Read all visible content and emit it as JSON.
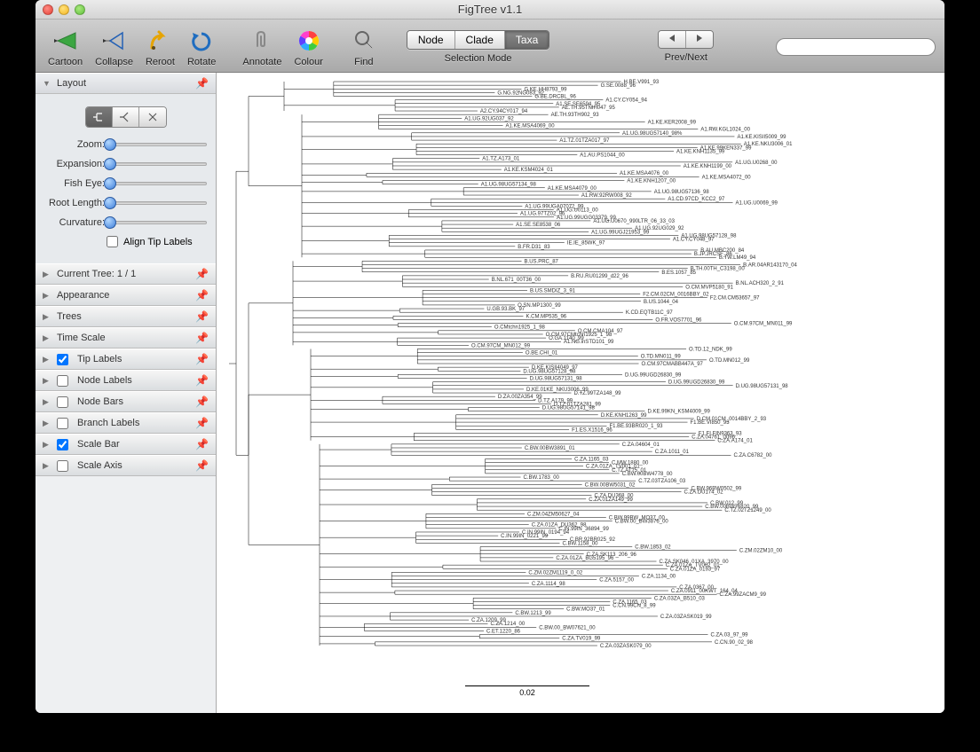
{
  "window": {
    "title": "FigTree v1.1"
  },
  "toolbar": {
    "cartoon": "Cartoon",
    "collapse": "Collapse",
    "reroot": "Reroot",
    "rotate": "Rotate",
    "annotate": "Annotate",
    "colour": "Colour",
    "find": "Find",
    "selection_mode_label": "Selection Mode",
    "selection_mode": {
      "node": "Node",
      "clade": "Clade",
      "taxa": "Taxa",
      "active": "Taxa"
    },
    "prev_next_label": "Prev/Next"
  },
  "search": {
    "placeholder": ""
  },
  "sidebar": {
    "layout": {
      "title": "Layout",
      "zoom": "Zoom:",
      "expansion": "Expansion:",
      "fish_eye": "Fish Eye:",
      "root_length": "Root Length:",
      "curvature": "Curvature:",
      "align_tip_labels": "Align Tip Labels"
    },
    "panels": [
      {
        "label": "Current Tree: 1 / 1",
        "checkbox": null
      },
      {
        "label": "Appearance",
        "checkbox": null
      },
      {
        "label": "Trees",
        "checkbox": null
      },
      {
        "label": "Time Scale",
        "checkbox": null
      },
      {
        "label": "Tip Labels",
        "checkbox": true
      },
      {
        "label": "Node Labels",
        "checkbox": false
      },
      {
        "label": "Node Bars",
        "checkbox": false
      },
      {
        "label": "Branch Labels",
        "checkbox": false
      },
      {
        "label": "Scale Bar",
        "checkbox": true
      },
      {
        "label": "Scale Axis",
        "checkbox": false
      }
    ]
  },
  "scalebar": {
    "value": "0.02"
  },
  "tip_labels": [
    "H.BE.V991_93",
    "G.SE.0088_96",
    "G.KE.HH8793_99",
    "G.NG.92NG083_92",
    "G.BE.DRCBL_96",
    "A1.CY.CY054_94",
    "A1.SE.SE6594_95",
    "AE.TH.95TNIH047_95",
    "A2.CY.94CY017_94",
    "AE.TH.93TH902_93",
    "A1.UG.92UG037_92",
    "A1.KE.KER2008_99",
    "A1.KE.MSA4069_00",
    "A1.RW.KGL1024_00",
    "A1.UG.98UG57140_98%",
    "A1.KE.KISII5009_99",
    "A1.TZ.01TZA017_97",
    "A1.KE.NKU3006_01",
    "A1.KE.99KEN337_99",
    "A1.KE.KNH1135_99",
    "A1.AU.PS1044_00",
    "A1.TZ.A173_01",
    "A1.UG.U0268_00",
    "A1.KE.KNH1199_00",
    "A1.KE.KSM4024_01",
    "A1.KE.MSA4076_00",
    "A1.KE.MSA4072_00",
    "A1.KE.KNH1207_00",
    "A1.UG.98UG57134_98",
    "A1.KE.MSA4079_00",
    "A1.UG.98UG57136_98",
    "A1.RW.92RW008_92",
    "A1.CD.97CD_KCC2_97",
    "A1.UG.U0069_99",
    "A1.UG.99UGA07072_99",
    "A1.UG.U0113_00",
    "A1.UG.97TZ02_96",
    "A1.UG.99UGG03379_99",
    "A1.UG.U0670_990LTR_06_33_03",
    "A1.SE.SE8538_06",
    "A1.UG.92UG029_92",
    "A1.UG.99UGJ21953_99",
    "A1.UG.98UG57128_98",
    "A1.CY.CY048_97",
    "IE.IE_85WK_97",
    "B.FR.D31_83",
    "B.AU.MBC200_84",
    "B.JP.JRCSF_86",
    "B.TW.LM49_94",
    "B.US.PRC_87",
    "B.AR.04AR143170_04",
    "B.TH.00TH_C3198_00",
    "B.ES.1057_85",
    "B.RU.RU01299_d22_96",
    "B.NL.671_00T36_00",
    "B.NL.ACH320_2_91",
    "O.CM.MVP5180_91",
    "B.US.SMDIZ_3_91",
    "F2.CM.02CM_0016BBY_02",
    "F2.CM.CM53657_97",
    "B.US.1044_04",
    "O.SN.MP1300_99",
    "U.GB.93.BK_97",
    "K.CD.EQTB11C_97",
    "K.CM.MP535_96",
    "O.FR.VOS7701_96",
    "O.CM.97CM_MN011_99",
    "O.CMtchn1925_1_98",
    "O.CM.CMA104_97",
    "O.CM.97CMtchn1925_1_98",
    "O.GA.1140_99",
    "A1.NG.inSTD101_99",
    "O.CM.97CM_MN012_99",
    "O.TD.12_NDK_99",
    "O.BE.CHI_01",
    "O.TD.MN011_99",
    "O.TD.MN012_99",
    "O.CM.97CMABB447A_97",
    "D.KE.KISII4049_97",
    "D.UG.98UG57128_98",
    "D.UG.99UGD26830_99",
    "D.UG.98UG57131_98",
    "D.UG.99UGD26830_99",
    "D.UG.98UG57131_98",
    "D.KE.01KE_NKU3006_99",
    "D.TZ.99TZA148_99",
    "D.ZA.00ZA354_99",
    "D.TZ.A179_99",
    "D.TZ.01TZA281_99",
    "D.UG.98UG57141_98",
    "D.KE.99KN_KSM4009_99",
    "D.KE.KNH1263_99",
    "D.CM.01CM_0014BBY_2_93",
    "F1.BE.VI850_93",
    "F1.BE.93BR020_1_93",
    "F1.ES.X1516_96",
    "F1.FI.FIN9363_93",
    "C.ZA.04761_0096",
    "C.ZA.A174_01",
    "C.ZA.04604_01",
    "C.BW.00BW3891_01",
    "C.ZA.1011_01",
    "C.ZA.C6782_00",
    "C.ZA.1165_03",
    "C.MW.1880_00",
    "C.ZA.01ZA_TV001_01",
    "C.TZ.AT75_01",
    "C.BW.00BW4778_00",
    "C.BW.1783_00",
    "C.TZ.03TZA106_03",
    "C.BW.00BW5031_02",
    "C.BW.96BW0502_99",
    "C.ZA.DU174_02",
    "C.ZA.DU368_00",
    "C.ZA.01ZA149_99",
    "C.BW.012_99",
    "C.BW.00BW76820_99",
    "C.TZ.02TZ1249_00",
    "C.ZM.04ZM50627_04",
    "C.BW.99BW_MO37_00",
    "C.BW.00_BW3876_00",
    "C.ZA.01ZA_DU362_98",
    "C.IN.99IN_36894_99",
    "C.IN.99IN_0194_94",
    "C.IN.99IN_0221_99",
    "C.BR.92BR025_92",
    "C.BW.1158_00",
    "C.BW.1853_02",
    "C.ZM.02ZM10_00",
    "C.ZA.SK113_206_96",
    "C.ZA.01ZA_BG5195_96",
    "C.ZA.SK046_01XA_3970_00",
    "C.ZA.01ZA_TV002_01",
    "C.ZA.01ZA_0193_97",
    "C.ZM.02ZM1119_0_02",
    "C.ZA.1134_00",
    "C.ZA.5157_00",
    "C.ZA.1114_98",
    "C.ZA.0367_00",
    "C.ZA.0911_00KWT_164_04",
    "C.ZA.99ZACM9_99",
    "C.ZA.03ZA_B510_03",
    "C.ZA.1165_03",
    "C.CN.99CN_8_99",
    "C.BW.MO37_01",
    "C.BW.1213_99",
    "C.ZA.03ZASK019_99",
    "C.ZA.1209_99",
    "C.ZA.1214_00",
    "C.BW.00_BW07621_00",
    "C.ET.1220_86",
    "C.ZA.03_97_99",
    "C.ZA.TV019_99",
    "C.CN.90_02_98",
    "C.ZA.03ZASK079_00"
  ]
}
